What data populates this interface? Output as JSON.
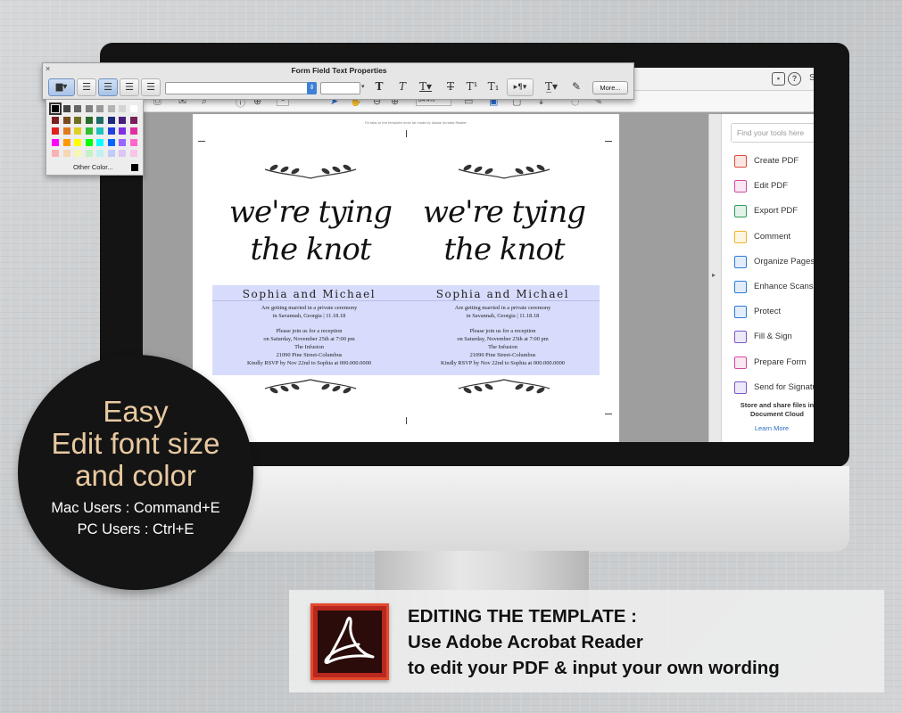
{
  "form_field_toolbar": {
    "title": "Form Field Text Properties",
    "close_glyph": "×",
    "font_dropdown_value": "",
    "size_dropdown_value": "",
    "more_label": "More...",
    "align_left_icon": "align-left-icon",
    "align_center_icon": "align-center-icon",
    "align_right_icon": "align-right-icon",
    "justify_icon": "justify-icon"
  },
  "color_palette": {
    "other_color_label": "Other Color...",
    "swatch_colors": [
      [
        "#000000",
        "#444444",
        "#666666",
        "#808080",
        "#999999",
        "#b3b3b3",
        "#d4d4d4",
        "#ffffff"
      ],
      [
        "#7a1f1f",
        "#7a4a1f",
        "#707020",
        "#2a6a2a",
        "#1f6a6a",
        "#1f2a7a",
        "#4a1f7a",
        "#7a1f5a"
      ],
      [
        "#e02020",
        "#e07a20",
        "#e0d020",
        "#30c030",
        "#20c0c0",
        "#2040e0",
        "#8030e0",
        "#e030a0"
      ],
      [
        "#ff00ff",
        "#ff9900",
        "#ffff00",
        "#00ff00",
        "#00ffff",
        "#0066ff",
        "#9966ff",
        "#ff66cc"
      ],
      [
        "#f7b3b3",
        "#f7d6b3",
        "#f7f7b3",
        "#c6f0c6",
        "#c0f0f0",
        "#c0ccf7",
        "#dcc6f7",
        "#f7c6e6"
      ]
    ]
  },
  "document": {
    "page_note": "Fill tabs to the template must be made by Adobe Acrobat Reader",
    "cards": [
      {
        "title_line1": "we're tying",
        "title_line2": "the knot",
        "names": "Sophia and Michael",
        "details": [
          "Are getting married in a private ceremony",
          "in Savannah, Georgia | 11.18.18",
          "",
          "Please join us for a reception",
          "on Saturday, November 25th at 7:00 pm",
          "The Infusion",
          "21090 Pine Street-Columbus",
          "Kindly RSVP by Nov 22nd to Sophia at 000.000.0000"
        ]
      },
      {
        "title_line1": "we're tying",
        "title_line2": "the knot",
        "names": "Sophia and Michael",
        "details": [
          "Are getting married in a private ceremony",
          "in Savannah, Georgia | 11.18.18",
          "",
          "Please join us for a reception",
          "on Saturday, November 25th at 7:00 pm",
          "The Infusion",
          "21090 Pine Street-Columbus",
          "Kindly RSVP by Nov 22nd to Sophia at 000.000.0000"
        ]
      }
    ]
  },
  "toolbar": {
    "zoom_value": "84.4%",
    "page_number": "1"
  },
  "tools_panel": {
    "search_placeholder": "Find your tools here",
    "tools": [
      {
        "label": "Create PDF",
        "icon": "create-pdf-icon",
        "color": "#d94b36"
      },
      {
        "label": "Edit PDF",
        "icon": "edit-pdf-icon",
        "color": "#d14ba0"
      },
      {
        "label": "Export PDF",
        "icon": "export-pdf-icon",
        "color": "#2f9b57"
      },
      {
        "label": "Comment",
        "icon": "comment-icon",
        "color": "#f0b429"
      },
      {
        "label": "Organize Pages",
        "icon": "organize-pages-icon",
        "color": "#2e7bd6"
      },
      {
        "label": "Enhance Scans",
        "icon": "enhance-scans-icon",
        "color": "#2e7bd6"
      },
      {
        "label": "Protect",
        "icon": "protect-icon",
        "color": "#2e7bd6"
      },
      {
        "label": "Fill & Sign",
        "icon": "fill-sign-icon",
        "color": "#7a58c7"
      },
      {
        "label": "Prepare Form",
        "icon": "prepare-form-icon",
        "color": "#d14ba0"
      },
      {
        "label": "Send for Signatu",
        "icon": "send-signature-icon",
        "color": "#7a58c7"
      }
    ],
    "share_text_line1": "Store and share files in",
    "share_text_line2": "Document Cloud",
    "learn_more": "Learn More"
  },
  "header": {
    "right_initial": "S",
    "comment_icon": "comment-bubble-icon",
    "help_icon": "help-icon"
  },
  "promo": {
    "line1": "Easy",
    "line2": "Edit font size",
    "line3": "and color",
    "mac": "Mac Users : Command+E",
    "pc": "PC Users : Ctrl+E"
  },
  "banner": {
    "heading": "EDITING THE TEMPLATE :",
    "line2": "Use Adobe Acrobat Reader",
    "line3": "to edit your PDF & input your own wording",
    "logo_icon": "adobe-acrobat-logo-icon"
  },
  "colors": {
    "promo_text": "#e8c9a0",
    "field_highlight": "#d8dcfc",
    "acrobat_red": "#b8281e"
  }
}
